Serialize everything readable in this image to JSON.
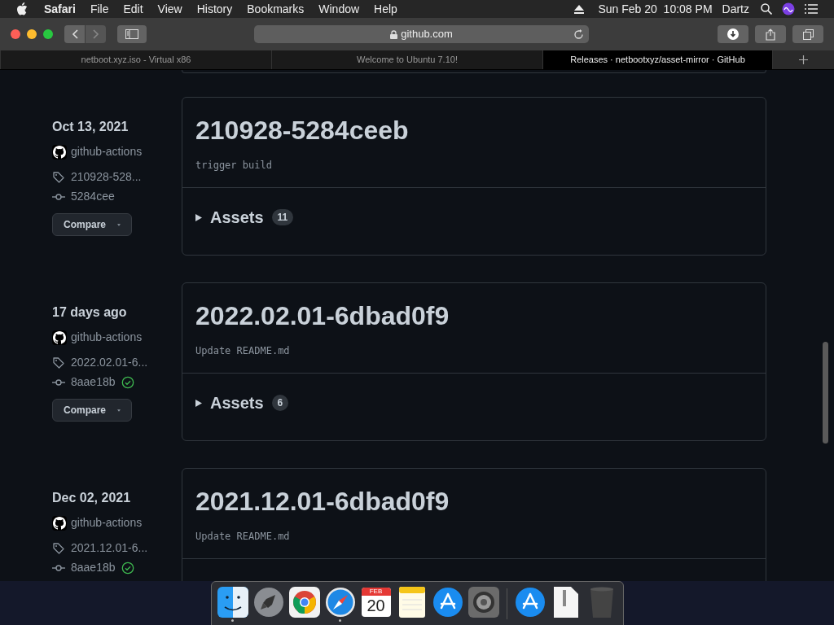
{
  "menu_bar": {
    "app": "Safari",
    "items": [
      "File",
      "Edit",
      "View",
      "History",
      "Bookmarks",
      "Window",
      "Help"
    ],
    "clock": "Sun Feb 20  10:08 PM",
    "user": "Dartz"
  },
  "toolbar": {
    "address": "github.com"
  },
  "tabs": [
    {
      "label": "netboot.xyz.iso - Virtual x86",
      "selected": false
    },
    {
      "label": "Welcome to Ubuntu 7.10!",
      "selected": false
    },
    {
      "label": "Releases · netbootxyz/asset-mirror · GitHub",
      "selected": true
    }
  ],
  "releases": [
    {
      "date": "Oct 13, 2021",
      "author": "github-actions",
      "tag": "210928-528...",
      "commit": "5284cee",
      "verified": false,
      "compare": "Compare",
      "title": "210928-5284ceeb",
      "message": "trigger build",
      "assets_label": "Assets",
      "assets_count": "11"
    },
    {
      "date": "17 days ago",
      "author": "github-actions",
      "tag": "2022.02.01-6...",
      "commit": "8aae18b",
      "verified": true,
      "compare": "Compare",
      "title": "2022.02.01-6dbad0f9",
      "message": "Update README.md",
      "assets_label": "Assets",
      "assets_count": "6"
    },
    {
      "date": "Dec 02, 2021",
      "author": "github-actions",
      "tag": "2021.12.01-6...",
      "commit": "8aae18b",
      "verified": true,
      "title": "2021.12.01-6dbad0f9",
      "message": "Update README.md"
    }
  ],
  "dock": [
    {
      "kind": "finder",
      "running": true
    },
    {
      "kind": "launchpad",
      "running": false
    },
    {
      "kind": "chrome",
      "running": false
    },
    {
      "kind": "safari",
      "running": true
    },
    {
      "kind": "calendar",
      "running": false,
      "month": "FEB",
      "day": "20"
    },
    {
      "kind": "notes",
      "running": false
    },
    {
      "kind": "appstore",
      "running": false
    },
    {
      "kind": "settings",
      "running": false
    },
    {
      "kind": "separator"
    },
    {
      "kind": "appstore",
      "running": false
    },
    {
      "kind": "document",
      "running": false
    },
    {
      "kind": "trash",
      "running": false
    }
  ]
}
